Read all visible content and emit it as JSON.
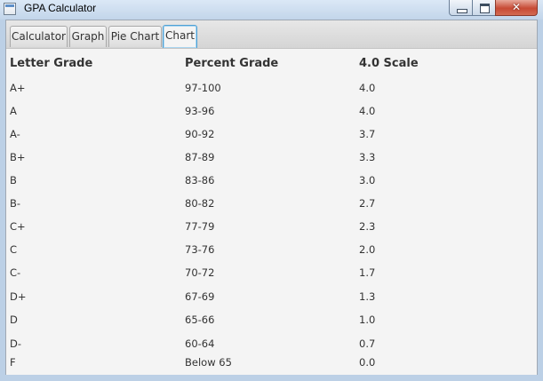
{
  "window": {
    "title": "GPA Calculator",
    "close_glyph": "✕"
  },
  "tabs": [
    {
      "label": "Calculator",
      "active": false
    },
    {
      "label": "Graph",
      "active": false
    },
    {
      "label": "Pie Chart",
      "active": false
    },
    {
      "label": "Chart",
      "active": true
    }
  ],
  "table": {
    "headers": [
      "Letter Grade",
      "Percent Grade",
      "4.0 Scale"
    ],
    "rows": [
      [
        "A+",
        "97-100",
        "4.0"
      ],
      [
        "A",
        "93-96",
        "4.0"
      ],
      [
        "A-",
        "90-92",
        "3.7"
      ],
      [
        "B+",
        "87-89",
        "3.3"
      ],
      [
        "B",
        "83-86",
        "3.0"
      ],
      [
        "B-",
        "80-82",
        "2.7"
      ],
      [
        "C+",
        "77-79",
        "2.3"
      ],
      [
        "C",
        "73-76",
        "2.0"
      ],
      [
        "C-",
        "70-72",
        "1.7"
      ],
      [
        "D+",
        "67-69",
        "1.3"
      ],
      [
        "D",
        "65-66",
        "1.0"
      ],
      [
        "D-",
        "60-64",
        "0.7"
      ],
      [
        "F",
        "Below 65",
        "0.0"
      ]
    ]
  },
  "colors": {
    "active_tab_border": "#4fa0d4",
    "close_button": "#c74a35"
  }
}
